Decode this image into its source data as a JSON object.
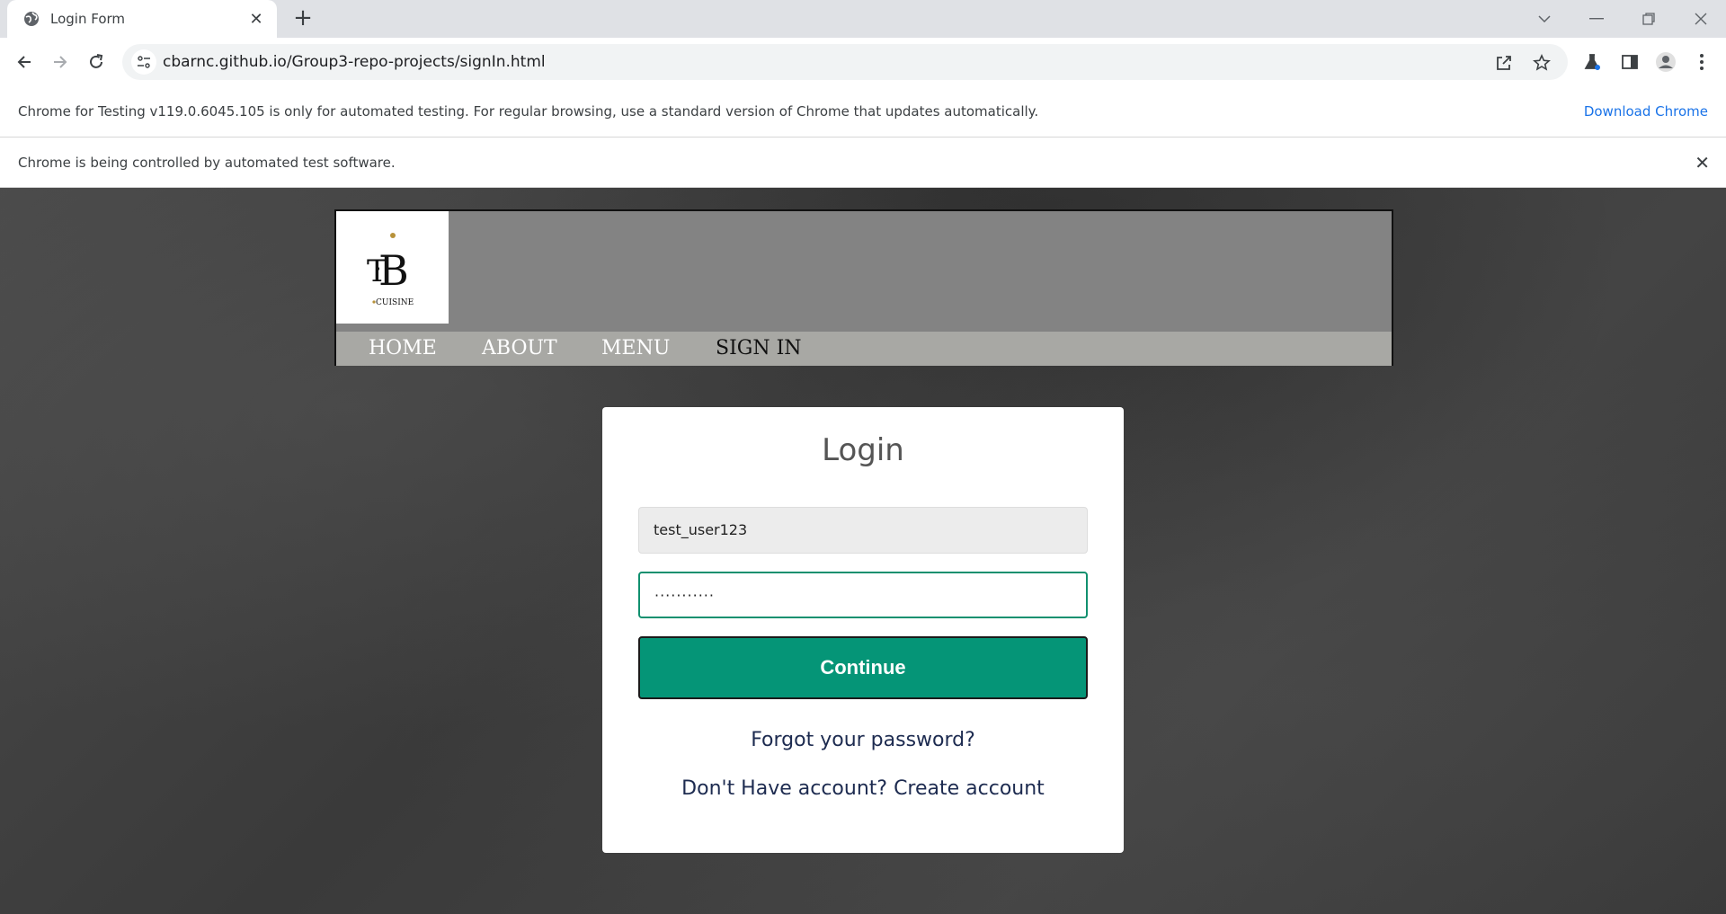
{
  "browser": {
    "tab_title": "Login Form",
    "url": "cbarnc.github.io/Group3-repo-projects/signIn.html",
    "testing_notice": "Chrome for Testing v119.0.6045.105 is only for automated testing. For regular browsing, use a standard version of Chrome that updates automatically.",
    "download_label": "Download Chrome",
    "automation_notice": "Chrome is being controlled by automated test software."
  },
  "site": {
    "logo_letters": "B",
    "logo_text": "CUISINE",
    "nav": {
      "home": "HOME",
      "about": "ABOUT",
      "menu": "MENU",
      "signin": "SIGN IN"
    }
  },
  "login": {
    "title": "Login",
    "username_value": "test_user123",
    "password_mask": "···········",
    "continue_label": "Continue",
    "forgot_link": "Forgot your password?",
    "create_link": "Don't Have account? Create account"
  },
  "colors": {
    "accent": "#059577",
    "link": "#1d2b50",
    "header_bg": "#838383",
    "nav_bg": "#a8a8a4",
    "chrome_link": "#1a73e8"
  }
}
